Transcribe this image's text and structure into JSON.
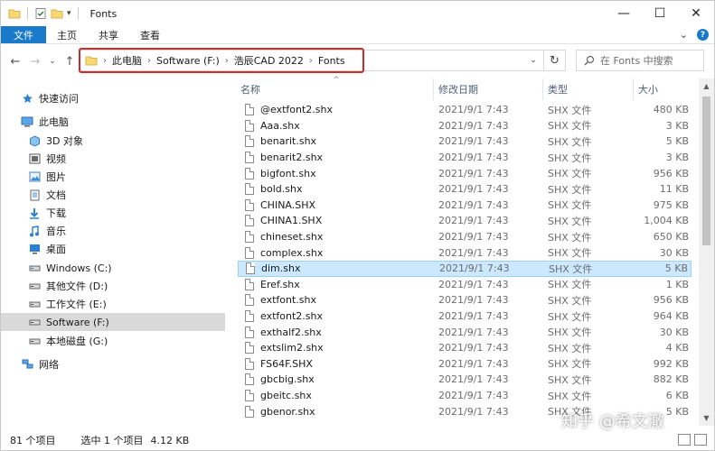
{
  "window": {
    "title": "Fonts"
  },
  "window_controls": {
    "minimize": "—",
    "maximize": "☐",
    "close": "✕"
  },
  "ribbon": {
    "tabs": [
      "文件",
      "主页",
      "共享",
      "查看"
    ],
    "expand": "⌄",
    "help": "?"
  },
  "nav": {
    "back": "←",
    "forward": "→",
    "recent": "⌄",
    "up": "↑"
  },
  "address": {
    "breadcrumbs": [
      "此电脑",
      "Software (F:)",
      "浩辰CAD 2022",
      "Fonts"
    ],
    "separator": "›",
    "dropdown": "⌄"
  },
  "refresh": "↻",
  "search": {
    "placeholder": "在 Fonts 中搜索"
  },
  "sidebar": {
    "items": [
      {
        "label": "快速访问",
        "icon": "star-icon"
      },
      {
        "label": "此电脑",
        "icon": "computer-icon"
      },
      {
        "label": "3D 对象",
        "icon": "cube-icon"
      },
      {
        "label": "视频",
        "icon": "video-icon"
      },
      {
        "label": "图片",
        "icon": "picture-icon"
      },
      {
        "label": "文档",
        "icon": "document-icon"
      },
      {
        "label": "下载",
        "icon": "download-icon"
      },
      {
        "label": "音乐",
        "icon": "music-icon"
      },
      {
        "label": "桌面",
        "icon": "desktop-icon"
      },
      {
        "label": "Windows (C:)",
        "icon": "drive-icon"
      },
      {
        "label": "其他文件 (D:)",
        "icon": "drive-icon"
      },
      {
        "label": "工作文件 (E:)",
        "icon": "drive-icon"
      },
      {
        "label": "Software (F:)",
        "icon": "drive-icon"
      },
      {
        "label": "本地磁盘 (G:)",
        "icon": "drive-icon"
      },
      {
        "label": "网络",
        "icon": "network-icon"
      }
    ],
    "selected_index": 12
  },
  "columns": {
    "name": "名称",
    "date": "修改日期",
    "type": "类型",
    "size": "大小"
  },
  "files": [
    {
      "name": "@extfont2.shx",
      "date": "2021/9/1 7:43",
      "type": "SHX 文件",
      "size": "480 KB"
    },
    {
      "name": "Aaa.shx",
      "date": "2021/9/1 7:43",
      "type": "SHX 文件",
      "size": "3 KB"
    },
    {
      "name": "benarit.shx",
      "date": "2021/9/1 7:43",
      "type": "SHX 文件",
      "size": "5 KB"
    },
    {
      "name": "benarit2.shx",
      "date": "2021/9/1 7:43",
      "type": "SHX 文件",
      "size": "3 KB"
    },
    {
      "name": "bigfont.shx",
      "date": "2021/9/1 7:43",
      "type": "SHX 文件",
      "size": "956 KB"
    },
    {
      "name": "bold.shx",
      "date": "2021/9/1 7:43",
      "type": "SHX 文件",
      "size": "11 KB"
    },
    {
      "name": "CHINA.SHX",
      "date": "2021/9/1 7:43",
      "type": "SHX 文件",
      "size": "975 KB"
    },
    {
      "name": "CHINA1.SHX",
      "date": "2021/9/1 7:43",
      "type": "SHX 文件",
      "size": "1,004 KB"
    },
    {
      "name": "chineset.shx",
      "date": "2021/9/1 7:43",
      "type": "SHX 文件",
      "size": "650 KB"
    },
    {
      "name": "complex.shx",
      "date": "2021/9/1 7:43",
      "type": "SHX 文件",
      "size": "30 KB"
    },
    {
      "name": "dim.shx",
      "date": "2021/9/1 7:43",
      "type": "SHX 文件",
      "size": "5 KB"
    },
    {
      "name": "Eref.shx",
      "date": "2021/9/1 7:43",
      "type": "SHX 文件",
      "size": "1 KB"
    },
    {
      "name": "extfont.shx",
      "date": "2021/9/1 7:43",
      "type": "SHX 文件",
      "size": "956 KB"
    },
    {
      "name": "extfont2.shx",
      "date": "2021/9/1 7:43",
      "type": "SHX 文件",
      "size": "964 KB"
    },
    {
      "name": "exthalf2.shx",
      "date": "2021/9/1 7:43",
      "type": "SHX 文件",
      "size": "30 KB"
    },
    {
      "name": "extslim2.shx",
      "date": "2021/9/1 7:43",
      "type": "SHX 文件",
      "size": "4 KB"
    },
    {
      "name": "FS64F.SHX",
      "date": "2021/9/1 7:43",
      "type": "SHX 文件",
      "size": "992 KB"
    },
    {
      "name": "gbcbig.shx",
      "date": "2021/9/1 7:43",
      "type": "SHX 文件",
      "size": "882 KB"
    },
    {
      "name": "gbeitc.shx",
      "date": "2021/9/1 7:43",
      "type": "SHX 文件",
      "size": "6 KB"
    },
    {
      "name": "gbenor.shx",
      "date": "2021/9/1 7:43",
      "type": "SHX 文件",
      "size": "5 KB"
    }
  ],
  "selected_file_index": 10,
  "status": {
    "item_count": "81 个项目",
    "selection": "选中 1 个项目",
    "selection_size": "4.12 KB"
  },
  "watermark": "知乎 @希文澈",
  "colors": {
    "accent": "#1979ca",
    "selected_row": "#cce8ff",
    "highlight_box": "#d02b2b"
  }
}
